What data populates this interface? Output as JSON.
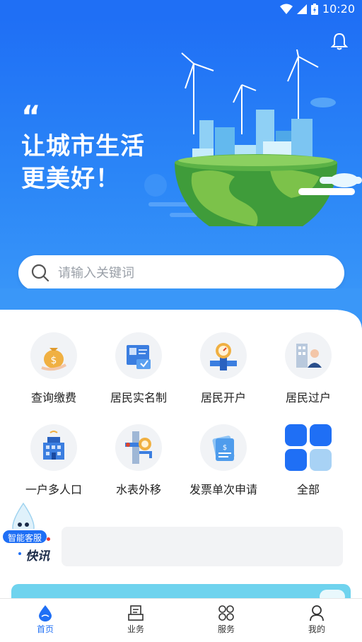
{
  "status_bar": {
    "time": "10:20"
  },
  "hero": {
    "quote_mark": "“",
    "slogan_line1": "让城市生活",
    "slogan_line2": "更美好！"
  },
  "search": {
    "placeholder": "请输入关键词"
  },
  "grid": [
    {
      "label": "查询缴费",
      "icon": "money-bag-icon"
    },
    {
      "label": "居民实名制",
      "icon": "id-card-icon"
    },
    {
      "label": "居民开户",
      "icon": "water-meter-icon"
    },
    {
      "label": "居民过户",
      "icon": "transfer-user-icon"
    },
    {
      "label": "一户多人口",
      "icon": "building-icon"
    },
    {
      "label": "水表外移",
      "icon": "pipe-meter-icon"
    },
    {
      "label": "发票单次申请",
      "icon": "invoice-icon"
    },
    {
      "label": "全部",
      "icon": "all-grid-icon"
    }
  ],
  "service": {
    "badge": "智能客服"
  },
  "news": {
    "label": "快讯"
  },
  "tabs": [
    {
      "label": "首页",
      "icon": "water-drop-icon",
      "active": true
    },
    {
      "label": "业务",
      "icon": "business-icon",
      "active": false
    },
    {
      "label": "服务",
      "icon": "service-grid-icon",
      "active": false
    },
    {
      "label": "我的",
      "icon": "user-icon",
      "active": false
    }
  ],
  "colors": {
    "primary": "#1f6ff5",
    "hero_light": "#3a97f8",
    "grid_bg": "#f1f3f6"
  }
}
